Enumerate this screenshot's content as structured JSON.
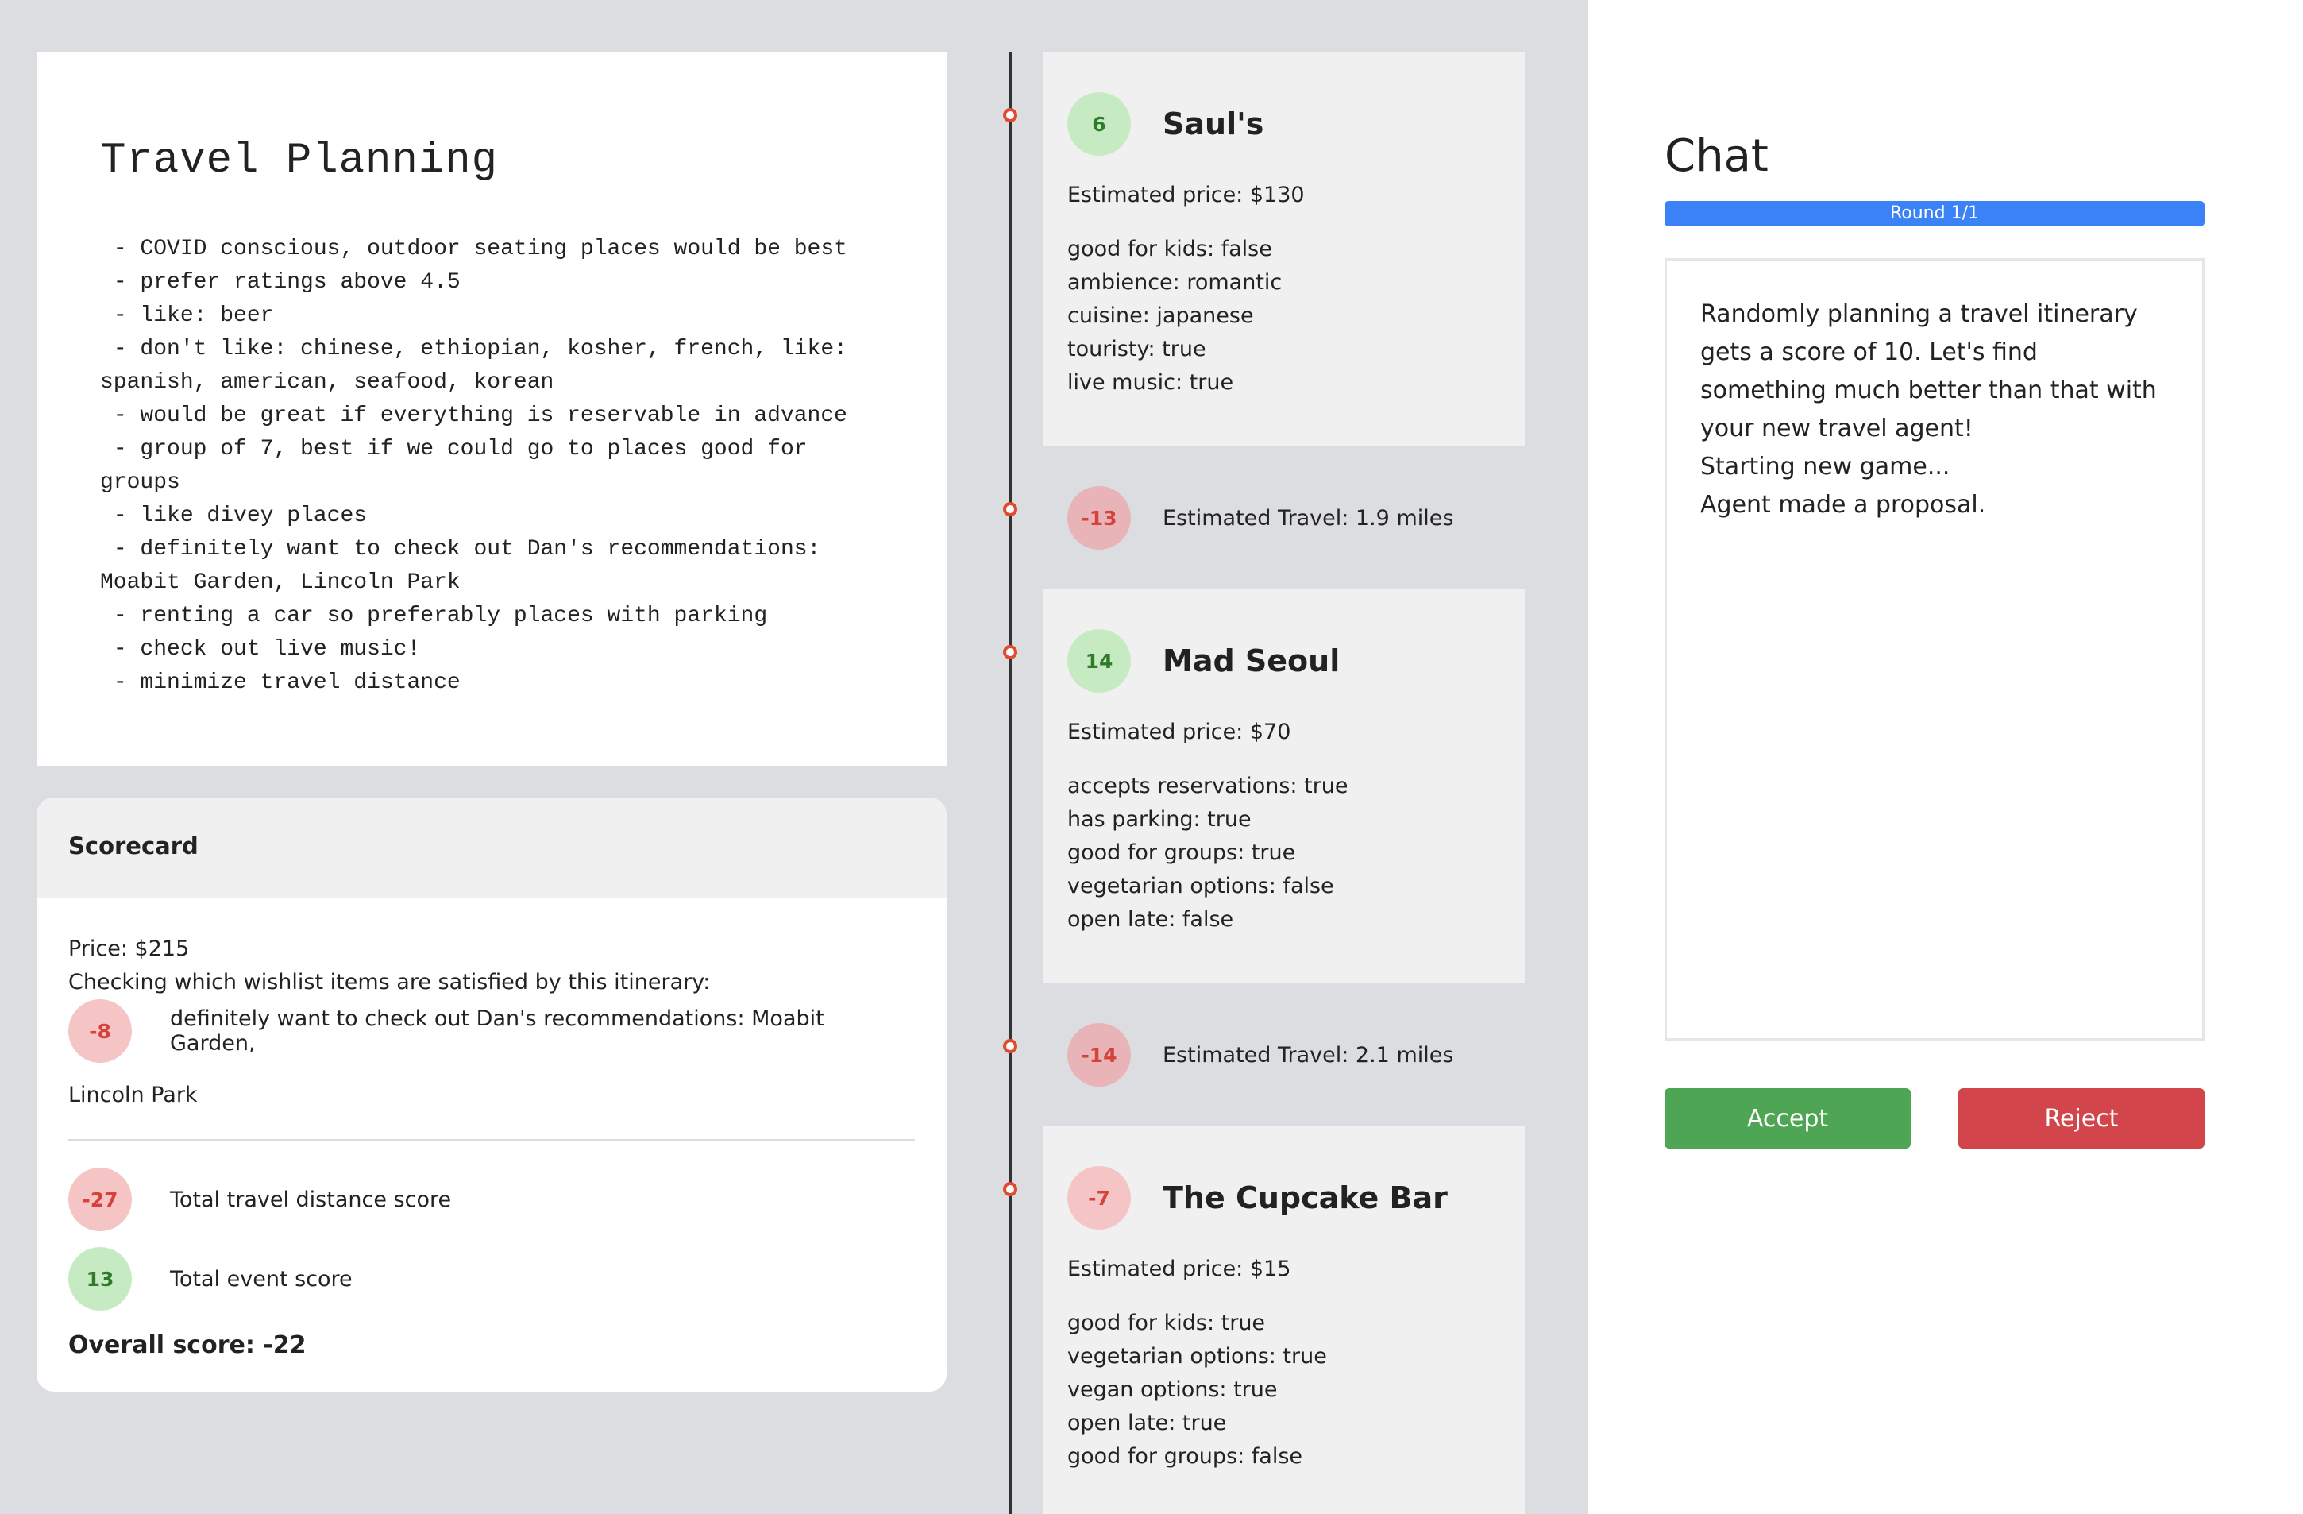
{
  "plan": {
    "title": "Travel Planning",
    "items": [
      " - COVID conscious, outdoor seating places would be best",
      " - prefer ratings above 4.5",
      " - like: beer",
      " - don't like: chinese, ethiopian, kosher, french, like: spanish, american, seafood, korean",
      " - would be great if everything is reservable in advance",
      " - group of 7, best if we could go to places good for groups",
      " - like divey places",
      " - definitely want to check out Dan's recommendations: Moabit Garden, Lincoln Park",
      " - renting a car so preferably places with parking",
      " - check out live music!",
      " - minimize travel distance"
    ]
  },
  "scorecard": {
    "title": "Scorecard",
    "price": "Price: $215",
    "checking": "Checking which wishlist items are satisfied by this itinerary:",
    "wishlist": [
      {
        "score": "-8",
        "text_a": "definitely want to check out Dan's recommendations: Moabit Garden,",
        "text_b": "Lincoln Park"
      }
    ],
    "travel": {
      "score": "-27",
      "label": "Total travel distance score"
    },
    "event": {
      "score": "13",
      "label": "Total event score"
    },
    "overall": "Overall score: -22"
  },
  "events": [
    {
      "score": "6",
      "name": "Saul's",
      "price": "Estimated price: $130",
      "attrs": [
        "good for kids: false",
        "ambience: romantic",
        "cuisine: japanese",
        "touristy: true",
        "live music: true"
      ]
    },
    {
      "score": "14",
      "name": "Mad Seoul",
      "price": "Estimated price: $70",
      "attrs": [
        "accepts reservations: true",
        "has parking: true",
        "good for groups: true",
        "vegetarian options: false",
        "open late: false"
      ]
    },
    {
      "score": "-7",
      "name": "The Cupcake Bar",
      "price": "Estimated price: $15",
      "attrs": [
        "good for kids: true",
        "vegetarian options: true",
        "vegan options: true",
        "open late: true",
        "good for groups: false"
      ]
    }
  ],
  "travels": [
    {
      "score": "-13",
      "label": "Estimated Travel: 1.9 miles"
    },
    {
      "score": "-14",
      "label": "Estimated Travel: 2.1 miles"
    }
  ],
  "chat": {
    "title": "Chat",
    "round": "Round 1/1",
    "messages": [
      "Randomly planning a travel itinerary gets a score of 10. Let's find something much better than that with your new travel agent!",
      "Starting new game...",
      "Agent made a proposal."
    ],
    "accept_label": "Accept",
    "reject_label": "Reject"
  },
  "colors": {
    "accent_blue": "#3b82f6",
    "accept_green": "#4ea553",
    "reject_red": "#d1454b",
    "timeline_dot": "#e2492d"
  }
}
